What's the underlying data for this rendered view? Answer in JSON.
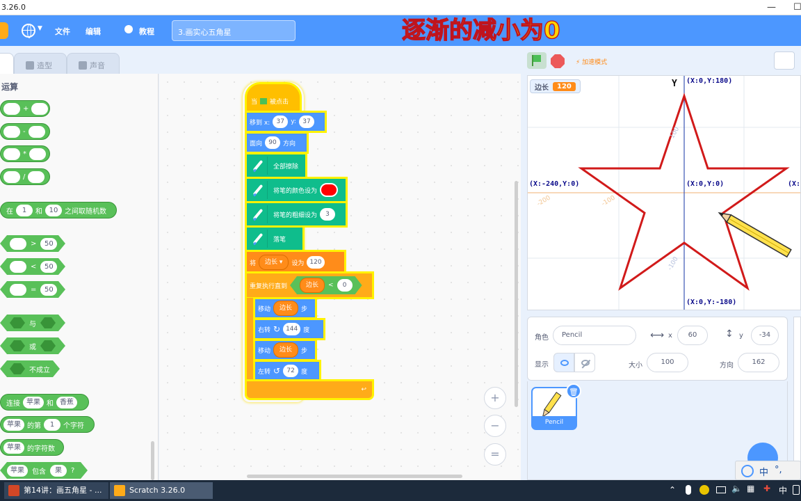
{
  "window": {
    "title": "3.26.0",
    "min": "—",
    "max": "☐"
  },
  "menubar": {
    "file": "文件",
    "edit": "编辑",
    "tutorials": "教程",
    "project_name": "3.画实心五角星",
    "overlay_caption": "逐渐的减小为0"
  },
  "tabs": {
    "costumes": "造型",
    "sounds": "声音"
  },
  "palette": {
    "category": "运算",
    "ops": [
      "+",
      "-",
      "*",
      "/"
    ],
    "random": {
      "pre": "在",
      "a": "1",
      "mid": "和",
      "b": "10",
      "post": "之间取随机数"
    },
    "compare": [
      {
        "op": ">",
        "val": "50"
      },
      {
        "op": "<",
        "val": "50"
      },
      {
        "op": "=",
        "val": "50"
      }
    ],
    "logic": [
      "与",
      "或",
      "不成立"
    ],
    "join": {
      "pre": "连接",
      "a": "苹果",
      "mid": "和",
      "b": "香蕉"
    },
    "letter": {
      "a": "苹果",
      "mid": "的第",
      "n": "1",
      "post": "个字符"
    },
    "length": {
      "a": "苹果",
      "post": "的字符数"
    },
    "contains": {
      "a": "苹果",
      "mid": "包含",
      "b": "果",
      "post": "?"
    }
  },
  "script": {
    "hat": {
      "pre": "当",
      "post": "被点击"
    },
    "goto": {
      "label": "移到 x:",
      "x": "37",
      "ylabel": "y:",
      "y": "37"
    },
    "point": {
      "label": "面向",
      "val": "90",
      "post": "方向"
    },
    "clear": "全部擦除",
    "setcolor": "将笔的颜色设为",
    "setsize": {
      "label": "将笔的粗细设为",
      "val": "3"
    },
    "pendown": "落笔",
    "setvar": {
      "pre": "将",
      "var": "边长 ▾",
      "mid": "设为",
      "val": "120"
    },
    "repeat": {
      "label": "重复执行直到",
      "var": "边长",
      "op": "<",
      "val": "0"
    },
    "move1": {
      "label": "移动",
      "var": "边长",
      "post": "步"
    },
    "turnright": {
      "label": "右转",
      "val": "144",
      "post": "度"
    },
    "move2": {
      "label": "移动",
      "var": "边长",
      "post": "步"
    },
    "turnleft": {
      "label": "左转",
      "val": "72",
      "post": "度"
    },
    "end_arrow": "↩"
  },
  "zoom": {
    "in": "+",
    "out": "−",
    "reset": "="
  },
  "stage_header": {
    "turbo": "⚡ 加速模式"
  },
  "stage": {
    "monitor": {
      "label": "边长",
      "value": "120"
    },
    "y_axis_label": "Y",
    "top_label": "(X:0,Y:180)",
    "bottom_label": "(X:0,Y:-180)",
    "left_label": "(X:-240,Y:0)",
    "center_label": "(X:0,Y:0)",
    "right_label": "(X:",
    "ticks": [
      "100",
      "-200",
      "-100",
      "-100"
    ]
  },
  "sprite_info": {
    "sprite_label": "角色",
    "sprite_name": "Pencil",
    "x_label": "x",
    "x": "60",
    "y_label": "y",
    "y": "-34",
    "show_label": "显示",
    "size_label": "大小",
    "size": "100",
    "dir_label": "方向",
    "dir": "162"
  },
  "sprite_list": {
    "name": "Pencil"
  },
  "taskbar": {
    "app1": "第14讲：画五角星 - ...",
    "app2": "Scratch 3.26.0",
    "ime": "中"
  },
  "colors": {
    "accent": "#4c97ff",
    "operators": "#59c059",
    "pen": "#0fbd8c",
    "variables": "#ff8c1a",
    "control": "#ffab19",
    "star": "#d11a1a"
  }
}
